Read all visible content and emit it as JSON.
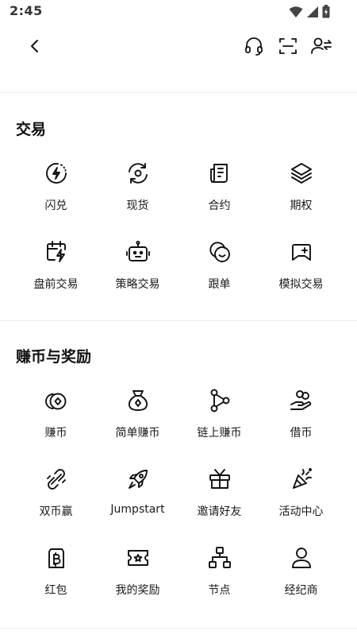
{
  "status_bar": {
    "time": "2:45"
  },
  "top_bar": {
    "back_icon": "chevron-left-icon",
    "actions": [
      "headset-icon",
      "scan-icon",
      "user-switch-icon"
    ]
  },
  "sections": {
    "trade": {
      "title": "交易",
      "items": [
        {
          "label": "闪兑",
          "icon": "flash-convert-icon"
        },
        {
          "label": "现货",
          "icon": "spot-icon"
        },
        {
          "label": "合约",
          "icon": "contract-icon"
        },
        {
          "label": "期权",
          "icon": "options-layers-icon"
        },
        {
          "label": "盘前交易",
          "icon": "calendar-bolt-icon"
        },
        {
          "label": "策略交易",
          "icon": "bot-icon"
        },
        {
          "label": "跟单",
          "icon": "copy-trade-icon"
        },
        {
          "label": "模拟交易",
          "icon": "gamepad-icon"
        }
      ]
    },
    "earn": {
      "title": "赚币与奖励",
      "items": [
        {
          "label": "赚币",
          "icon": "coins-icon"
        },
        {
          "label": "简单赚币",
          "icon": "money-bag-icon"
        },
        {
          "label": "链上赚币",
          "icon": "chain-nodes-icon"
        },
        {
          "label": "借币",
          "icon": "hand-coins-icon"
        },
        {
          "label": "双币赢",
          "icon": "dual-link-icon"
        },
        {
          "label": "Jumpstart",
          "icon": "rocket-icon"
        },
        {
          "label": "邀请好友",
          "icon": "gift-icon"
        },
        {
          "label": "活动中心",
          "icon": "party-popper-icon"
        },
        {
          "label": "红包",
          "icon": "red-envelope-icon"
        },
        {
          "label": "我的奖励",
          "icon": "ticket-icon"
        },
        {
          "label": "节点",
          "icon": "node-tree-icon"
        },
        {
          "label": "经纪商",
          "icon": "person-icon"
        }
      ]
    }
  }
}
